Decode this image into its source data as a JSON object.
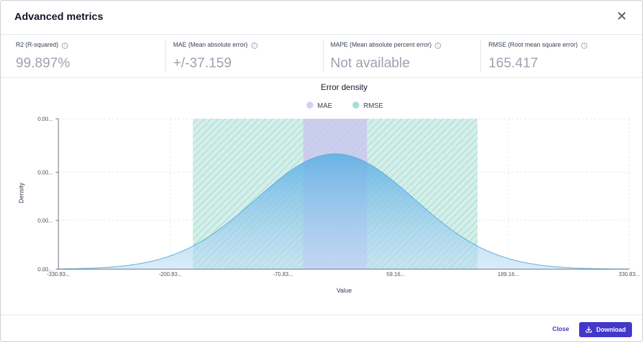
{
  "dialog": {
    "title": "Advanced metrics",
    "close_icon": "close-icon"
  },
  "metrics": [
    {
      "label": "R2 (R-squared)",
      "value": "99.897%",
      "icon": "info-icon"
    },
    {
      "label": "MAE (Mean absolute error)",
      "value": "+/-37.159",
      "icon": "info-icon"
    },
    {
      "label": "MAPE (Mean absolute percent error)",
      "value": "Not available",
      "icon": "info-icon"
    },
    {
      "label": "RMSE (Root mean square error)",
      "value": "165.417",
      "icon": "info-icon"
    }
  ],
  "chart_data": {
    "type": "area",
    "title": "Error density",
    "xlabel": "Value",
    "ylabel": "Density",
    "x_ticks": [
      "-330.83...",
      "-200.83...",
      "-70.83...",
      "59.16...",
      "189.16...",
      "330.83..."
    ],
    "y_ticks": [
      "0.00...",
      "0.00...",
      "0.00...",
      "0.00..."
    ],
    "legend": [
      {
        "name": "MAE",
        "color": "#d8cdf6"
      },
      {
        "name": "RMSE",
        "color": "#a8ddd4"
      }
    ],
    "legend_position": "top-center",
    "grid": true,
    "series": [
      {
        "name": "Density",
        "color": "#5aaee3",
        "mean": -10,
        "sd": 92
      }
    ],
    "bands": [
      {
        "name": "RMSE",
        "from": -175,
        "to": 155
      },
      {
        "name": "MAE",
        "from": -47,
        "to": 27
      }
    ],
    "xlim": [
      -330.83,
      330.83
    ]
  },
  "footer": {
    "close_label": "Close",
    "download_label": "Download",
    "download_icon": "download-icon"
  },
  "colors": {
    "accent": "#4338ca",
    "density_fill": "#5aaee3",
    "mae": "#d8cdf6",
    "rmse": "#a8ddd4"
  }
}
